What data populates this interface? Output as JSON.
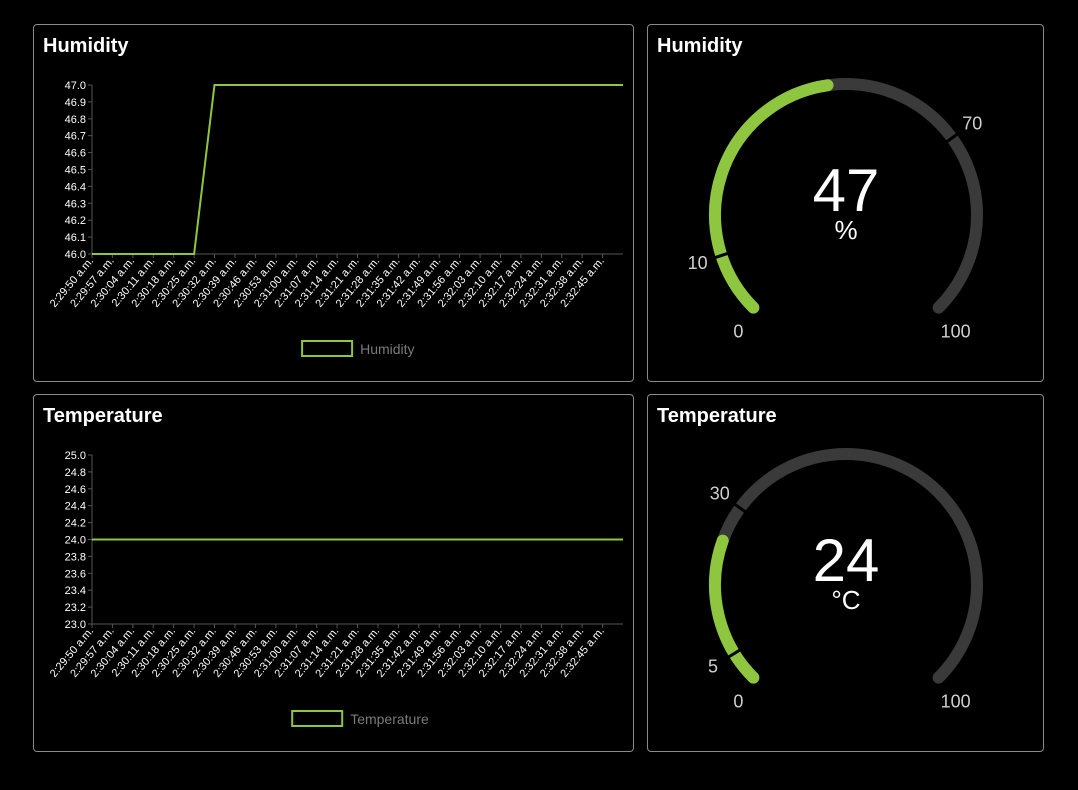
{
  "colors": {
    "accent": "#8ec63f",
    "track": "#3a3a3a",
    "border": "#8a8a8a",
    "background": "#000000"
  },
  "panels": {
    "humidity_chart": {
      "title": "Humidity",
      "legend": "Humidity"
    },
    "temperature_chart": {
      "title": "Temperature",
      "legend": "Temperature"
    },
    "humidity_gauge": {
      "title": "Humidity",
      "value": "47",
      "unit": "%",
      "min_label": "0",
      "max_label": "100",
      "low_label": "10",
      "high_label": "70",
      "min": 0,
      "max": 100,
      "val": 47,
      "low": 10,
      "high": 70
    },
    "temperature_gauge": {
      "title": "Temperature",
      "value": "24",
      "unit": "°C",
      "min_label": "0",
      "max_label": "100",
      "low_label": "5",
      "high_label": "30",
      "min": 0,
      "max": 100,
      "val": 24,
      "low": 5,
      "high": 30
    }
  },
  "chart_data": [
    {
      "type": "line",
      "title": "Humidity",
      "xlabel": "",
      "ylabel": "",
      "categories": [
        "2:29:50 a.m.",
        "2:29:57 a.m.",
        "2:30:04 a.m.",
        "2:30:11 a.m.",
        "2:30:18 a.m.",
        "2:30:25 a.m.",
        "2:30:32 a.m.",
        "2:30:39 a.m.",
        "2:30:46 a.m.",
        "2:30:53 a.m.",
        "2:31:00 a.m.",
        "2:31:07 a.m.",
        "2:31:14 a.m.",
        "2:31:21 a.m.",
        "2:31:28 a.m.",
        "2:31:35 a.m.",
        "2:31:42 a.m.",
        "2:31:49 a.m.",
        "2:31:56 a.m.",
        "2:32:03 a.m.",
        "2:32:10 a.m.",
        "2:32:17 a.m.",
        "2:32:24 a.m.",
        "2:32:31 a.m.",
        "2:32:38 a.m.",
        "2:32:45 a.m."
      ],
      "series": [
        {
          "name": "Humidity",
          "values": [
            46,
            46,
            46,
            46,
            46,
            46,
            47,
            47,
            47,
            47,
            47,
            47,
            47,
            47,
            47,
            47,
            47,
            47,
            47,
            47,
            47,
            47,
            47,
            47,
            47,
            47,
            47
          ]
        }
      ],
      "yticks": [
        "47.0",
        "46.9",
        "46.8",
        "46.7",
        "46.6",
        "46.5",
        "46.4",
        "46.3",
        "46.2",
        "46.1",
        "46.0"
      ],
      "ylim": [
        46.0,
        47.0
      ],
      "grid": false,
      "legend_position": "bottom"
    },
    {
      "type": "line",
      "title": "Temperature",
      "xlabel": "",
      "ylabel": "",
      "categories": [
        "2:29:50 a.m.",
        "2:29:57 a.m.",
        "2:30:04 a.m.",
        "2:30:11 a.m.",
        "2:30:18 a.m.",
        "2:30:25 a.m.",
        "2:30:32 a.m.",
        "2:30:39 a.m.",
        "2:30:46 a.m.",
        "2:30:53 a.m.",
        "2:31:00 a.m.",
        "2:31:07 a.m.",
        "2:31:14 a.m.",
        "2:31:21 a.m.",
        "2:31:28 a.m.",
        "2:31:35 a.m.",
        "2:31:42 a.m.",
        "2:31:49 a.m.",
        "2:31:56 a.m.",
        "2:32:03 a.m.",
        "2:32:10 a.m.",
        "2:32:17 a.m.",
        "2:32:24 a.m.",
        "2:32:31 a.m.",
        "2:32:38 a.m.",
        "2:32:45 a.m."
      ],
      "series": [
        {
          "name": "Temperature",
          "values": [
            24,
            24,
            24,
            24,
            24,
            24,
            24,
            24,
            24,
            24,
            24,
            24,
            24,
            24,
            24,
            24,
            24,
            24,
            24,
            24,
            24,
            24,
            24,
            24,
            24,
            24,
            24
          ]
        }
      ],
      "yticks": [
        "25.0",
        "24.8",
        "24.6",
        "24.4",
        "24.2",
        "24.0",
        "23.8",
        "23.6",
        "23.4",
        "23.2",
        "23.0"
      ],
      "ylim": [
        23.0,
        25.0
      ],
      "grid": false,
      "legend_position": "bottom"
    }
  ]
}
